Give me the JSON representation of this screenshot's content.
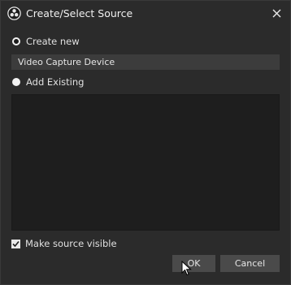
{
  "dialog": {
    "title": "Create/Select Source",
    "create_new_label": "Create new",
    "name_value": "Video Capture Device",
    "add_existing_label": "Add Existing",
    "make_visible_label": "Make source visible",
    "ok_label": "OK",
    "cancel_label": "Cancel",
    "create_new_checked": true,
    "add_existing_checked": false,
    "make_visible_checked": true
  },
  "icons": {
    "app": "obs-logo-icon",
    "close": "close-icon",
    "cursor": "mouse-cursor-icon"
  }
}
